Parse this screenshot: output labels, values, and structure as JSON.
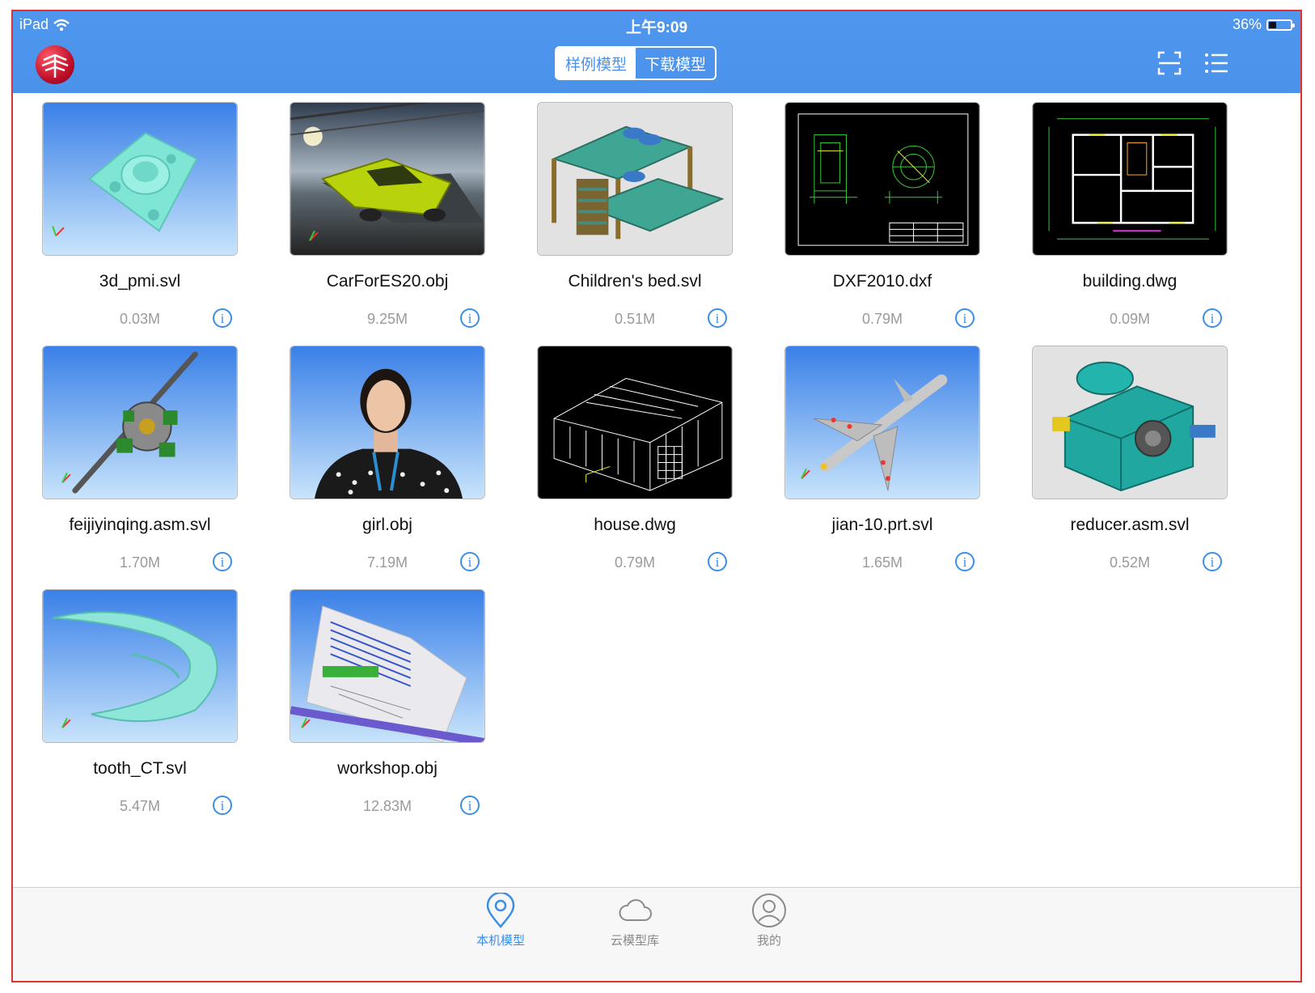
{
  "status_bar": {
    "device": "iPad",
    "time": "上午9:09",
    "battery": "36%",
    "battery_level": 0.36
  },
  "segment": {
    "items": [
      "样例模型",
      "下载模型"
    ],
    "selected_index": 0
  },
  "header_icons": [
    "scan-icon",
    "list-view-icon"
  ],
  "models": [
    {
      "name": "3d_pmi.svl",
      "size": "0.03M",
      "thumb": "bracket"
    },
    {
      "name": "CarForES20.obj",
      "size": "9.25M",
      "thumb": "car"
    },
    {
      "name": "Children's bed.svl",
      "size": "0.51M",
      "thumb": "bed"
    },
    {
      "name": "DXF2010.dxf",
      "size": "0.79M",
      "thumb": "cad-drawing"
    },
    {
      "name": "building.dwg",
      "size": "0.09M",
      "thumb": "floor-plan"
    },
    {
      "name": "feijiyinqing.asm.svl",
      "size": "1.70M",
      "thumb": "engine"
    },
    {
      "name": "girl.obj",
      "size": "7.19M",
      "thumb": "person"
    },
    {
      "name": "house.dwg",
      "size": "0.79M",
      "thumb": "wireframe-house"
    },
    {
      "name": "jian-10.prt.svl",
      "size": "1.65M",
      "thumb": "jet"
    },
    {
      "name": "reducer.asm.svl",
      "size": "0.52M",
      "thumb": "gearbox"
    },
    {
      "name": "tooth_CT.svl",
      "size": "5.47M",
      "thumb": "tooth"
    },
    {
      "name": "workshop.obj",
      "size": "12.83M",
      "thumb": "workshop"
    }
  ],
  "info_icon_glyph": "i",
  "tabbar": {
    "items": [
      {
        "label": "本机模型",
        "icon": "location-pin-icon",
        "active": true
      },
      {
        "label": "云模型库",
        "icon": "cloud-icon",
        "active": false
      },
      {
        "label": "我的",
        "icon": "user-icon",
        "active": false
      }
    ]
  },
  "colors": {
    "accent": "#4a92ea",
    "header_bg": "#4a92ea",
    "tab_active": "#3b8ee8",
    "tab_inactive": "#8a8a8a"
  }
}
